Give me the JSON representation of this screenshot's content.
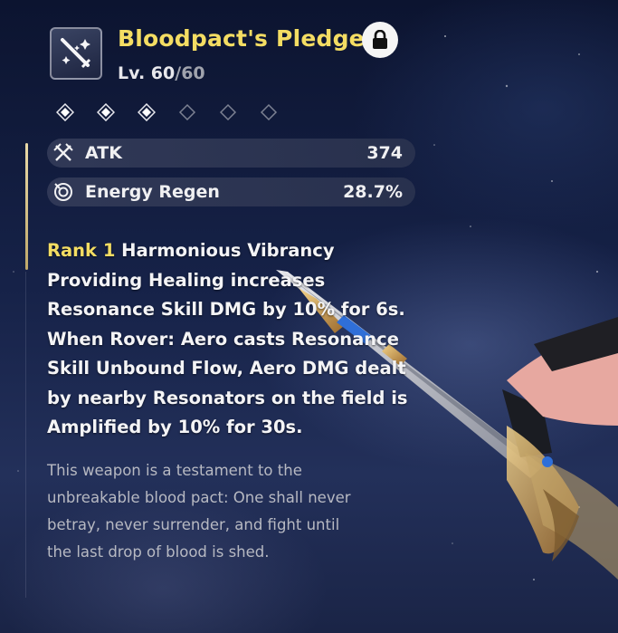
{
  "weapon": {
    "icon": "crossed-swords-icon",
    "name": "Bloodpact's Pledge",
    "level_prefix": "Lv. ",
    "level_current": "60",
    "level_sep": "/",
    "level_max": "60",
    "locked": true,
    "lock_icon": "lock-icon"
  },
  "rank": {
    "current": 3,
    "max": 6
  },
  "stats": [
    {
      "icon": "atk-icon",
      "label": "ATK",
      "value": "374"
    },
    {
      "icon": "energy-regen-icon",
      "label": "Energy Regen",
      "value": "28.7%"
    }
  ],
  "effect": {
    "rank_label": "Rank 1",
    "title": " Harmonious Vibrancy",
    "lines": [
      "Providing Healing increases",
      "Resonance Skill DMG by 10% for 6s.",
      "When Rover: Aero casts Resonance",
      "Skill Unbound Flow, Aero DMG dealt",
      "by nearby Resonators on the field is",
      "Amplified by 10% for 30s."
    ]
  },
  "lore": {
    "lines": [
      "This weapon is a testament to the",
      "unbreakable blood pact: One shall never",
      "betray, never surrender, and fight until",
      "the last drop of blood is shed."
    ]
  },
  "colors": {
    "title": "#f4dd63",
    "accent_rail": "#e9d9a8",
    "lore": "#b7b9c2"
  }
}
